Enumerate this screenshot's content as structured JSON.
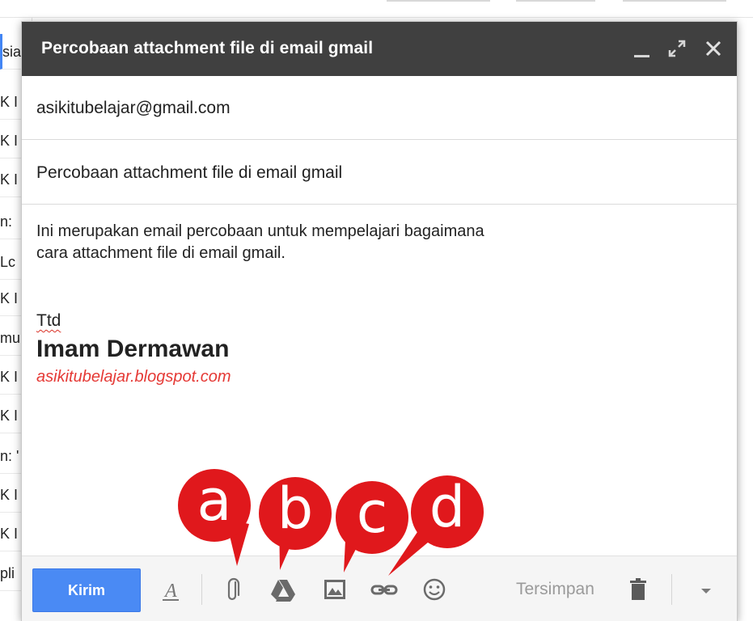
{
  "background": {
    "rows": [
      "sia",
      "K I",
      "K I",
      "K I",
      "n:",
      "Lc",
      "K I",
      "mu",
      "K I",
      "K I",
      "n: '",
      "K I",
      "K I",
      "pli"
    ]
  },
  "compose": {
    "title": "Percobaan attachment file di email gmail",
    "to": "asikitubelajar@gmail.com",
    "subject": "Percobaan attachment file di email gmail",
    "body_line1": "Ini merupakan email percobaan untuk mempelajari bagaimana",
    "body_line2": "cara attachment file di email gmail.",
    "signature": {
      "ttd": "Ttd",
      "name": "Imam Dermawan",
      "link": "asikitubelajar.blogspot.com"
    }
  },
  "toolbar": {
    "send_label": "Kirim",
    "saved_label": "Tersimpan"
  },
  "callouts": [
    "a",
    "b",
    "c",
    "d"
  ],
  "colors": {
    "titlebar": "#404040",
    "send_button": "#4a8af4",
    "callout": "#e0181c",
    "signature_link": "#e53935"
  }
}
